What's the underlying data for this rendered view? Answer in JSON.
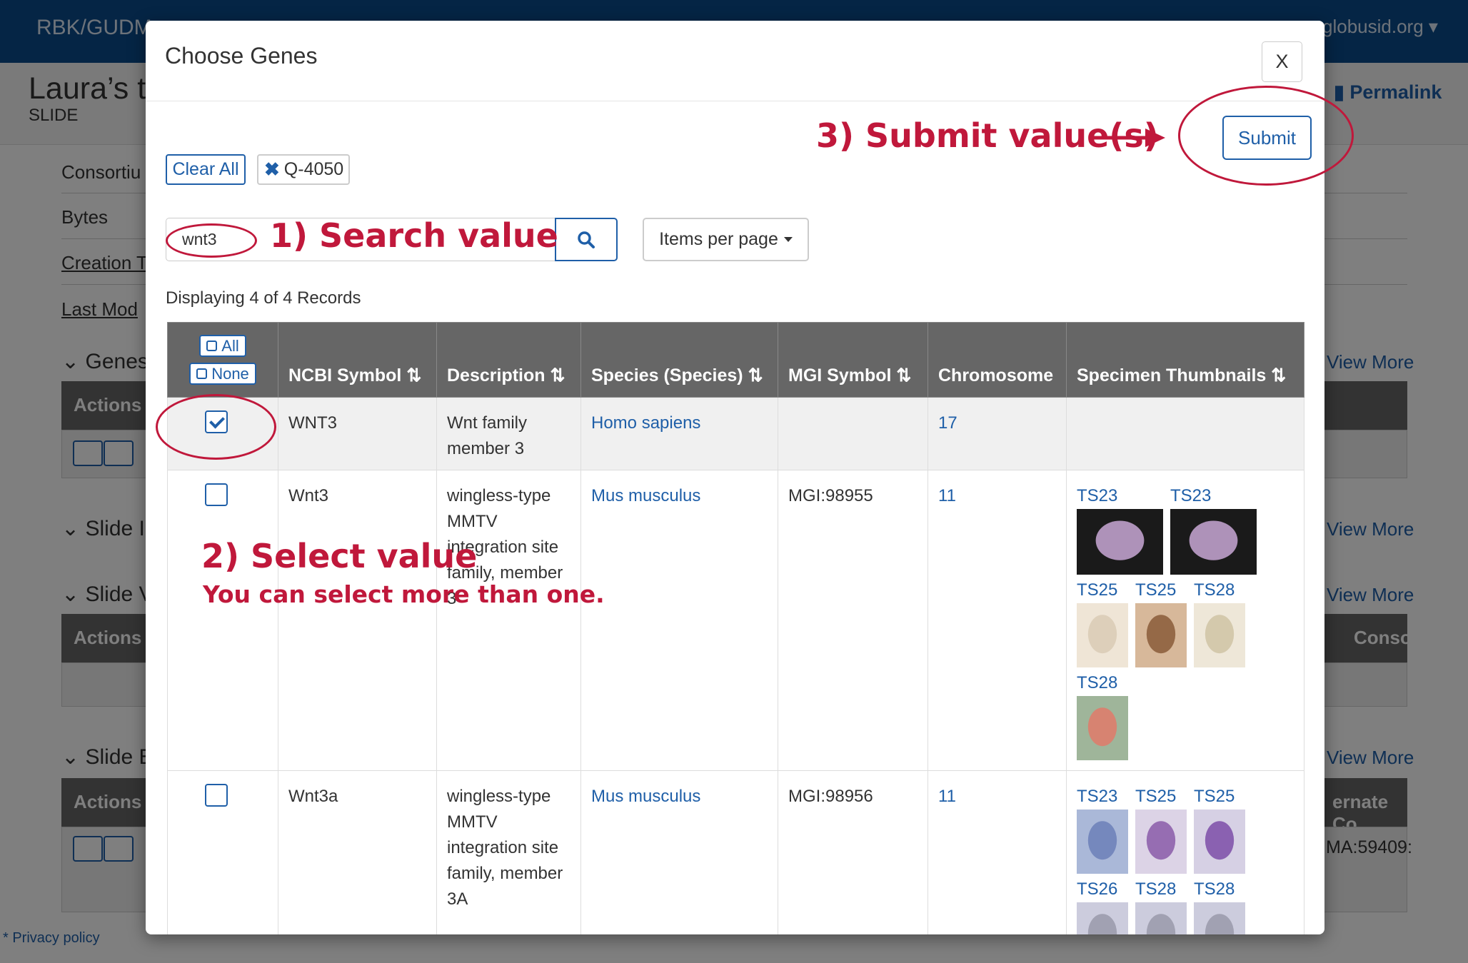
{
  "background": {
    "brand": "RBK/GUDM",
    "user": "globusid.org",
    "title": "Laura’s t",
    "subtitle": "SLIDE",
    "permalink": "Permalink",
    "rows": [
      "Consortiu",
      "Bytes",
      "Creation T",
      "Last Mod"
    ],
    "sections": [
      "Genes",
      "Slide I",
      "Slide V",
      "Slide E"
    ],
    "view_more": "View More",
    "actions_label": "Actions",
    "col_fragment_1": "Conso",
    "col_fragment_2": "ernate Co",
    "cell_fragment": "MA:59409:",
    "privacy": "* Privacy policy"
  },
  "modal": {
    "title": "Choose Genes",
    "close_label": "X",
    "submit_label": "Submit",
    "clear_all_label": "Clear All",
    "chip_label": "Q-4050",
    "search_value": "wnt3",
    "items_per_page_label": "Items per page",
    "displaying_text": "Displaying 4 of 4 Records",
    "select_all_label": "All",
    "select_none_label": "None",
    "columns": [
      "NCBI Symbol",
      "Description",
      "Species (Species)",
      "MGI Symbol",
      "Chromosome",
      "Specimen Thumbnails"
    ],
    "sort_glyph": "⇅",
    "rows": [
      {
        "checked": true,
        "ncbi_symbol": "WNT3",
        "description": "Wnt family member 3",
        "species": "Homo sapiens",
        "mgi_symbol": "",
        "chromosome": "17",
        "thumbnails": []
      },
      {
        "checked": false,
        "ncbi_symbol": "Wnt3",
        "description": "wingless-type MMTV integration site family, member 3",
        "species": "Mus musculus",
        "mgi_symbol": "MGI:98955",
        "chromosome": "11",
        "thumbnails": [
          {
            "label": "TS23",
            "color": "#1a1a1a",
            "accent": "#c9a8d6"
          },
          {
            "label": "TS23",
            "color": "#1a1a1a",
            "accent": "#c9a8d6"
          },
          {
            "label": "TS25",
            "color": "#efe5d6",
            "accent": "#d9cbb5"
          },
          {
            "label": "TS25",
            "color": "#d7b89a",
            "accent": "#8a5a38"
          },
          {
            "label": "TS28",
            "color": "#eee7d8",
            "accent": "#cfc3a5"
          },
          {
            "label": "TS28",
            "color": "#9fb59a",
            "accent": "#e07a6a"
          }
        ]
      },
      {
        "checked": false,
        "ncbi_symbol": "Wnt3a",
        "description": "wingless-type MMTV integration site family, member 3A",
        "species": "Mus musculus",
        "mgi_symbol": "MGI:98956",
        "chromosome": "11",
        "thumbnails": [
          {
            "label": "TS23",
            "color": "#aab8d8",
            "accent": "#6c7fb8"
          },
          {
            "label": "TS25",
            "color": "#dcd3e6",
            "accent": "#8a5aa8"
          },
          {
            "label": "TS25",
            "color": "#d6d0e4",
            "accent": "#7d4ea8"
          },
          {
            "label": "TS26",
            "color": "#ccd",
            "accent": "#99a"
          },
          {
            "label": "TS28",
            "color": "#ccd",
            "accent": "#99a"
          },
          {
            "label": "TS28",
            "color": "#ccd",
            "accent": "#99a"
          }
        ]
      }
    ]
  },
  "annotations": {
    "step1": "1) Search value",
    "step2_title": "2) Select value",
    "step2_sub": "You can select more than one.",
    "step3": "3) Submit value(s)",
    "color": "#c0183b"
  }
}
